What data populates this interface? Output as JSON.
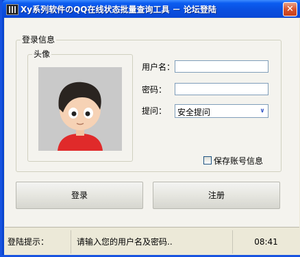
{
  "window": {
    "title": "Xy系列软件のQQ在线状态批量查询工具 － 论坛登陆",
    "close_label": "✕"
  },
  "login_group": {
    "label": "登录信息"
  },
  "avatar_group": {
    "label": "头像"
  },
  "fields": {
    "username_label": "用户名：",
    "username_value": "",
    "password_label": "密码：",
    "password_value": "",
    "question_label": "提问：",
    "question_value": "安全提问"
  },
  "remember": {
    "label": "保存账号信息",
    "checked": false
  },
  "buttons": {
    "login": "登录",
    "register": "注册"
  },
  "status": {
    "label": "登陆提示：",
    "message": "请输入您的用户名及密码..",
    "time": "08:41"
  }
}
